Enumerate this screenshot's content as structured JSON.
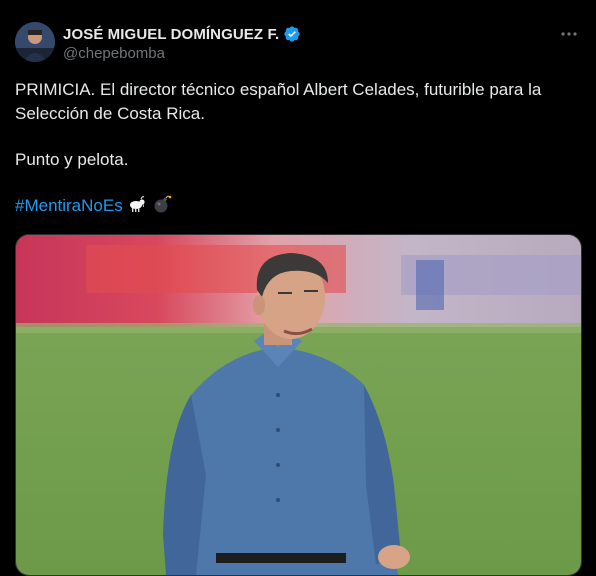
{
  "author": {
    "display_name": "JOSÉ MIGUEL DOMÍNGUEZ F.",
    "handle": "@chepebomba",
    "verified": true,
    "avatar_icon": "profile-photo"
  },
  "more_icon": "ellipsis-icon",
  "tweet": {
    "line1": "PRIMICIA. El director técnico español Albert Celades, futurible para la Selección de Costa Rica.",
    "line2": "Punto y pelota.",
    "hashtag": "#MentiraNoEs",
    "emojis": [
      "goat-emoji",
      "bomb-emoji"
    ]
  },
  "media": {
    "type": "photo",
    "subject": "coach-photo"
  },
  "colors": {
    "background": "#000000",
    "text": "#e7e9ea",
    "muted": "#71767b",
    "link": "#1d9bf0",
    "verified_badge": "#1d9bf0"
  }
}
